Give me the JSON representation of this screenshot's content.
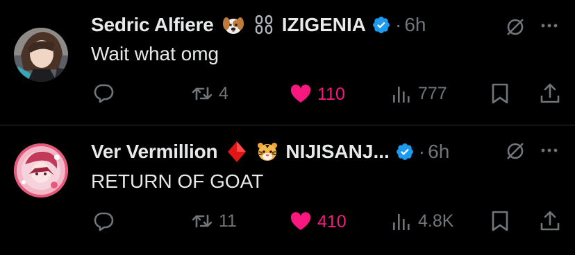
{
  "tweets": [
    {
      "display_name": "Sedric Alfiere",
      "emojis": [
        "dog-face-icon",
        "chain-icon"
      ],
      "account_name": "IZIGENIA",
      "verified": true,
      "separator": "·",
      "time": "6h",
      "text": "Wait what omg",
      "replies": "",
      "retweets": "4",
      "likes": "110",
      "views": "777",
      "liked": true
    },
    {
      "display_name": "Ver Vermillion",
      "emojis": [
        "red-diamond-icon",
        "tiger-face-icon"
      ],
      "account_name": "NIJISANJ...",
      "verified": true,
      "separator": "·",
      "time": "6h",
      "text": "RETURN OF GOAT",
      "replies": "",
      "retweets": "11",
      "likes": "410",
      "views": "4.8K",
      "liked": true
    }
  ],
  "colors": {
    "background": "#000000",
    "text": "#e7e9ea",
    "muted": "#71767b",
    "like": "#f91880",
    "verified": "#1d9bf0",
    "divider": "#2f3336"
  }
}
